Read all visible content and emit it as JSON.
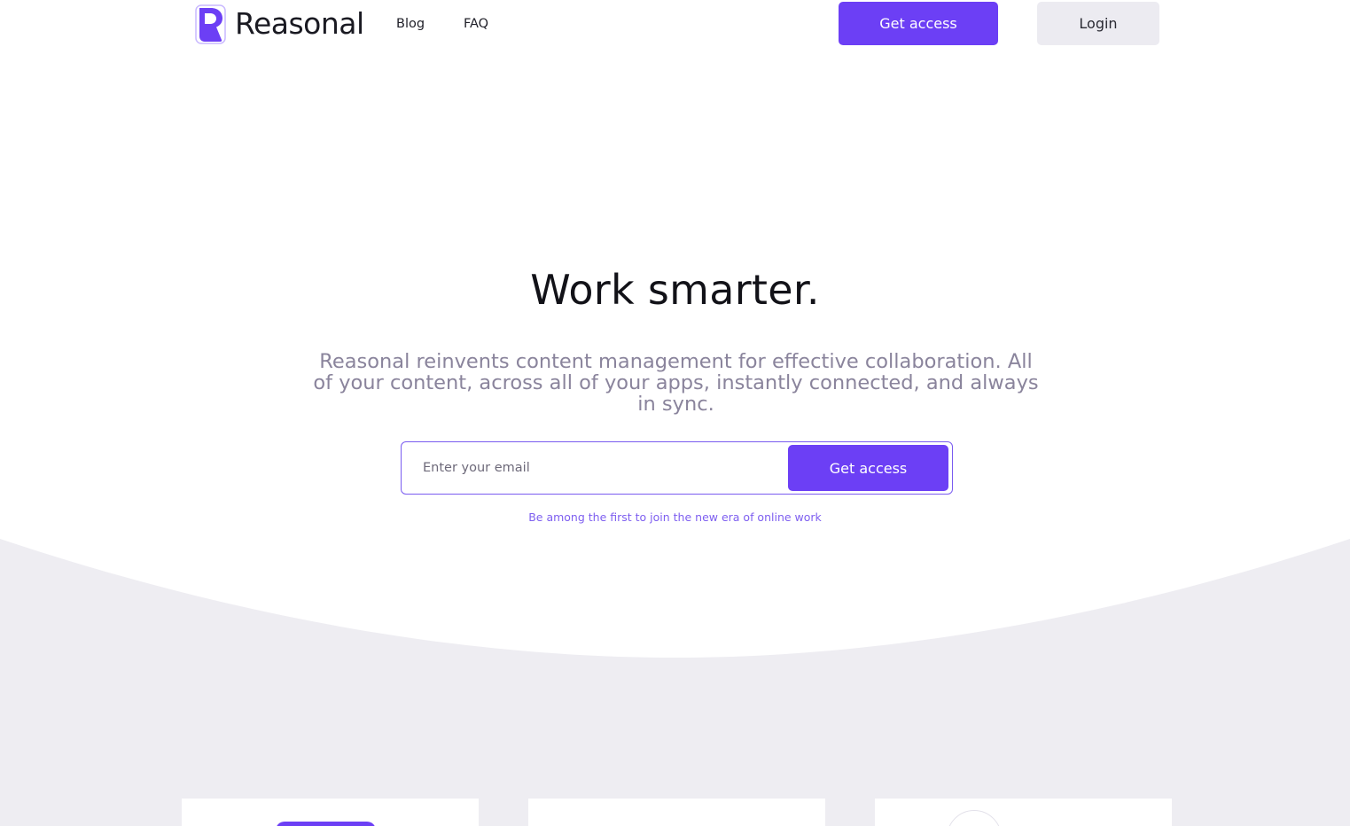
{
  "header": {
    "brand_name": "Reasonal",
    "logo_icon": "reasonal-r-logo-icon",
    "nav": [
      {
        "label": "Blog"
      },
      {
        "label": "FAQ"
      }
    ],
    "get_access_label": "Get access",
    "login_label": "Login"
  },
  "hero": {
    "title": "Work smarter.",
    "subtitle": "Reasonal reinvents content management for effective collaboration. All of your content, across all of your apps, instantly connected, and always in sync.",
    "email_placeholder": "Enter your email",
    "email_value": "",
    "cta_label": "Get access",
    "tagline": "Be among the first to join the new era of online work"
  },
  "colors": {
    "accent": "#6c3ff5",
    "secondary_button_bg": "#ecebf1",
    "section_bg": "#eeedf2",
    "subtitle_text": "#8a849c",
    "tagline_text": "#7e5ff0"
  }
}
